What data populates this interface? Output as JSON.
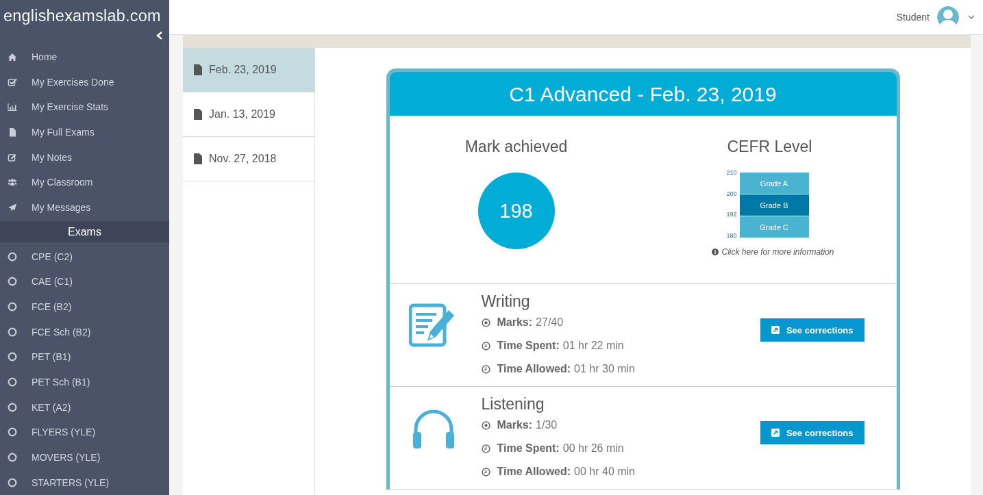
{
  "brand": "englishexamslab.com",
  "sidebar": {
    "items": [
      {
        "kind": "home",
        "label": "Home"
      },
      {
        "kind": "check",
        "label": "My Exercises Done"
      },
      {
        "kind": "chart",
        "label": "My Exercise Stats"
      },
      {
        "kind": "file",
        "label": "My Full Exams"
      },
      {
        "kind": "note",
        "label": "My Notes"
      },
      {
        "kind": "users",
        "label": "My Classroom"
      },
      {
        "kind": "send",
        "label": "My Messages"
      }
    ],
    "section": "Exams",
    "exams": [
      "CPE (C2)",
      "CAE (C1)",
      "FCE (B2)",
      "FCE Sch (B2)",
      "PET (B1)",
      "PET Sch (B1)",
      "KET (A2)",
      "FLYERS (YLE)",
      "MOVERS (YLE)",
      "STARTERS (YLE)"
    ]
  },
  "user": {
    "name": "Student"
  },
  "dates": [
    {
      "label": "Feb. 23, 2019",
      "selected": true
    },
    {
      "label": "Jan. 13, 2019",
      "selected": false
    },
    {
      "label": "Nov. 27, 2018",
      "selected": false
    }
  ],
  "result": {
    "title": "C1 Advanced - Feb. 23, 2019",
    "mark_heading": "Mark achieved",
    "mark": "198",
    "cefr_heading": "CEFR Level",
    "scale_ticks": [
      "210",
      "200",
      "192",
      "180"
    ],
    "bands": [
      {
        "label": "Grade A",
        "selected": false
      },
      {
        "label": "Grade B",
        "selected": true
      },
      {
        "label": "Grade C",
        "selected": false
      }
    ],
    "info_link": "Click here for more information",
    "papers": [
      {
        "kind": "writing",
        "name": "Writing",
        "stats": [
          {
            "kind": "marks",
            "label": "Marks:",
            "value": "27/40"
          },
          {
            "kind": "time",
            "label": "Time Spent:",
            "value": "01 hr 22 min"
          },
          {
            "kind": "time",
            "label": "Time Allowed:",
            "value": "01 hr 30 min"
          }
        ],
        "button": "See corrections"
      },
      {
        "kind": "listening",
        "name": "Listening",
        "stats": [
          {
            "kind": "marks",
            "label": "Marks:",
            "value": "1/30"
          },
          {
            "kind": "time",
            "label": "Time Spent:",
            "value": "00 hr 26 min"
          },
          {
            "kind": "time",
            "label": "Time Allowed:",
            "value": "00 hr 40 min"
          }
        ],
        "button": "See corrections"
      }
    ]
  }
}
